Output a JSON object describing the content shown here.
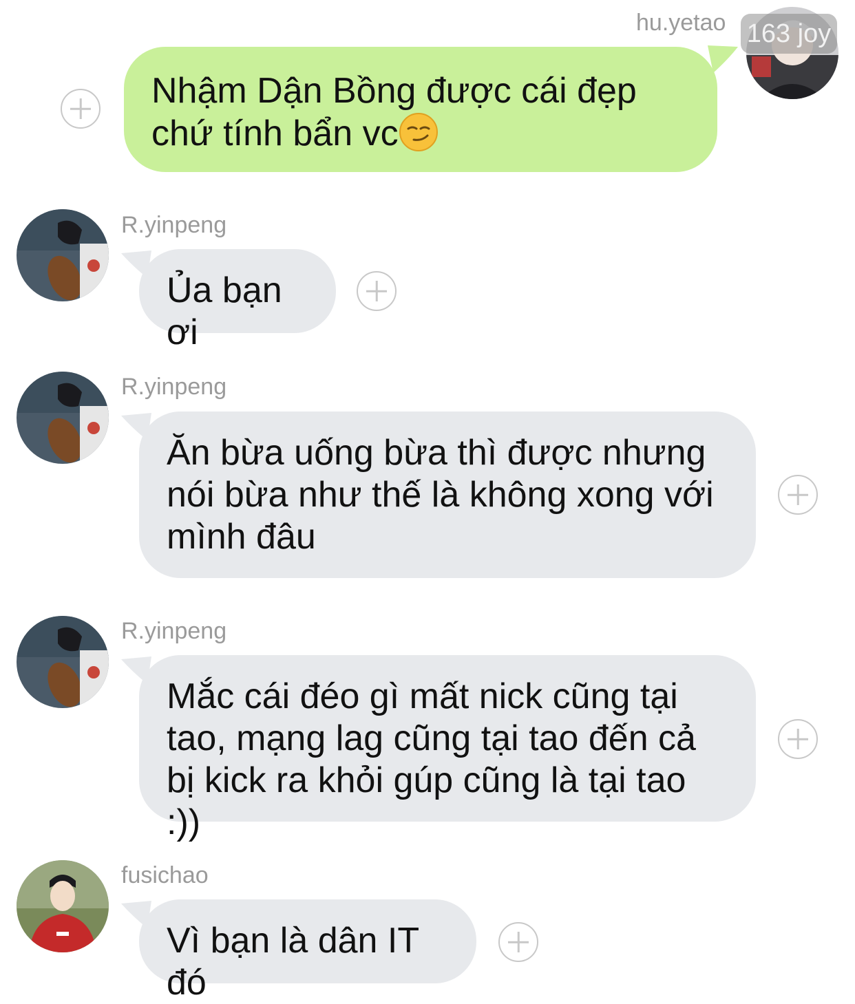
{
  "messages": [
    {
      "sender": "hu.yetao",
      "text": "Nhậm Dận Bồng được cái đẹp chứ tính bẩn vc",
      "emoji": "smirking-face",
      "outgoing": true
    },
    {
      "sender": "R.yinpeng",
      "text": "Ủa bạn ơi",
      "outgoing": false
    },
    {
      "sender": "R.yinpeng",
      "text": "Ăn bừa uống bừa thì được nhưng nói bừa như thế là không xong với mình đâu",
      "outgoing": false
    },
    {
      "sender": "R.yinpeng",
      "text": "Mắc cái đéo gì mất nick cũng tại tao, mạng lag cũng tại tao đến cả bị kick ra khỏi gúp cũng là tại tao :))",
      "outgoing": false
    },
    {
      "sender": "fusichao",
      "text": "Vì bạn là dân IT đó",
      "outgoing": false
    }
  ],
  "watermark": "163 joy",
  "colors": {
    "outgoing_bubble": "#c9f09a",
    "incoming_bubble": "#e7e9ec",
    "sender_name": "#9a9a9a",
    "plus_icon": "#c8c8c8"
  }
}
